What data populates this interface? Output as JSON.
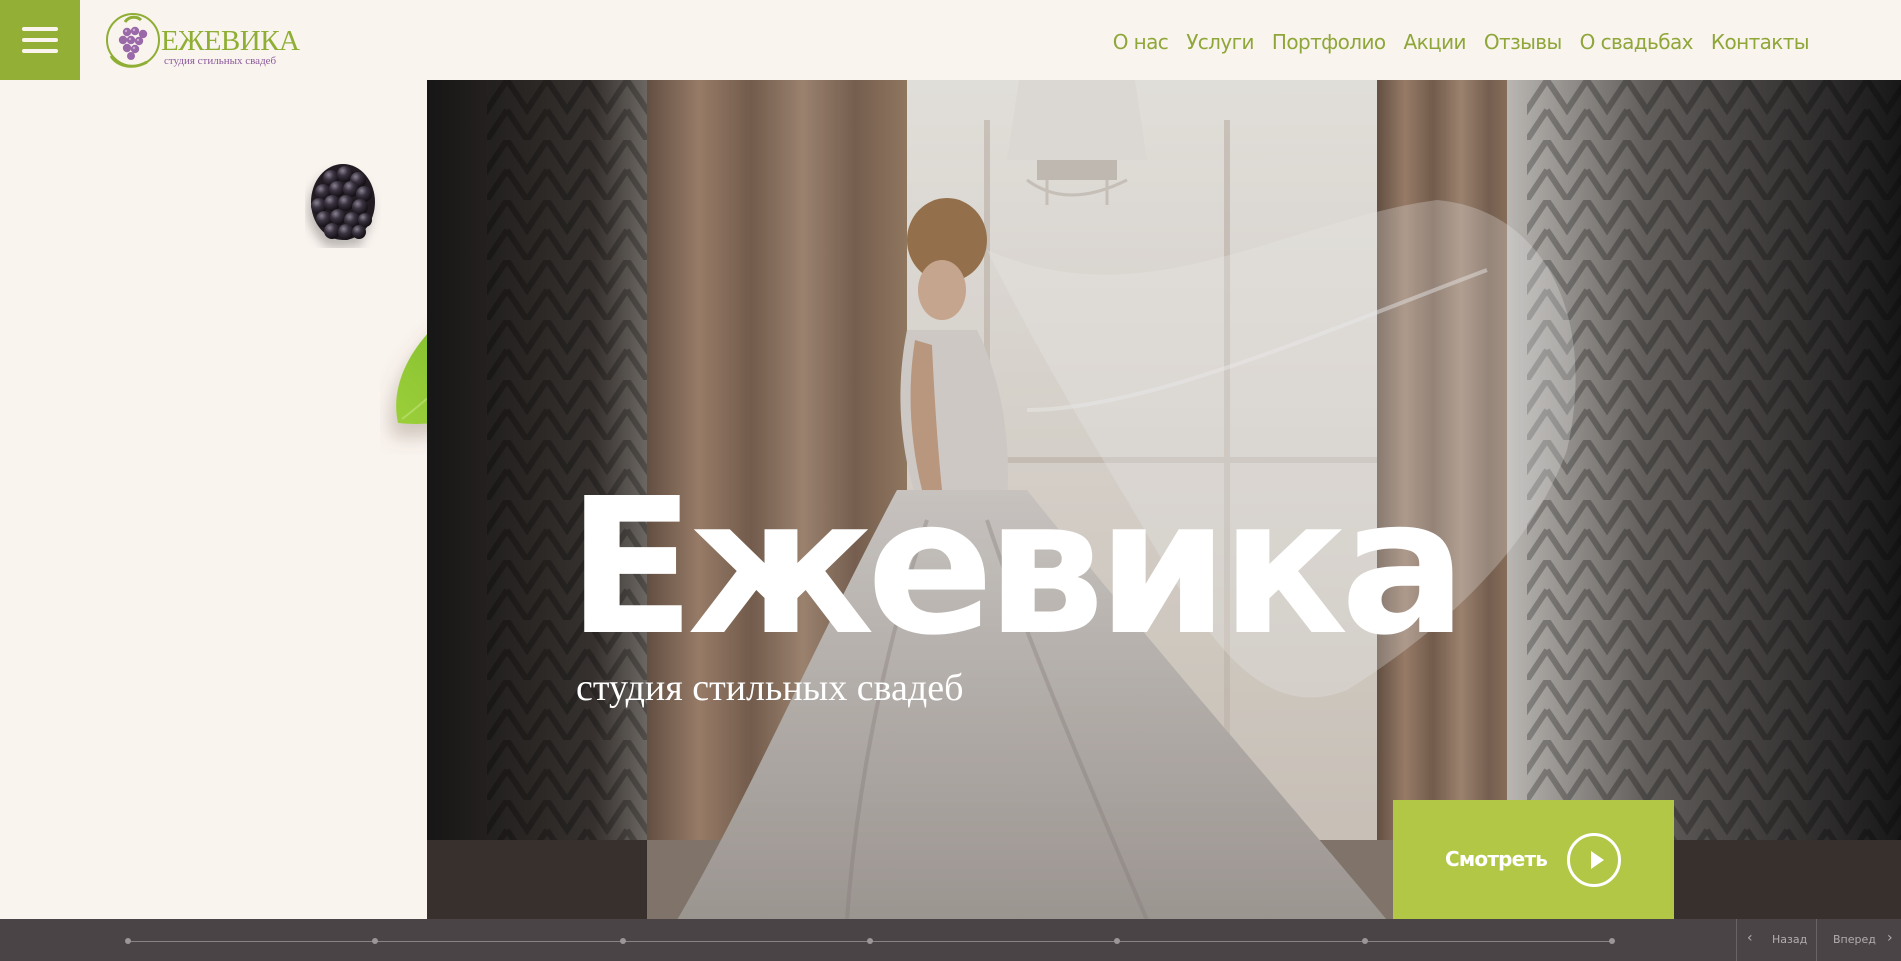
{
  "header": {
    "logo": {
      "name": "ЕЖЕВИКА",
      "tagline": "студия стильных свадеб"
    },
    "nav": [
      {
        "label": "О нас"
      },
      {
        "label": "Услуги"
      },
      {
        "label": "Портфолио"
      },
      {
        "label": "Акции"
      },
      {
        "label": "Отзывы"
      },
      {
        "label": "О свадьбах"
      },
      {
        "label": "Контакты"
      }
    ]
  },
  "hero": {
    "title": "Ежевика",
    "subtitle": "студия стильных свадеб",
    "watch_button": {
      "label": "Смотреть",
      "icon": "play-circle-icon"
    }
  },
  "slider": {
    "slide_count": 7,
    "prev_label": "Назад",
    "next_label": "Вперед"
  },
  "colors": {
    "accent_green": "#93af36",
    "button_green": "#b2c746",
    "nav_text": "#8fa639",
    "page_bg": "#faf4ef",
    "bottom_bar": "#4a4447",
    "logo_purple": "#8a5a9c"
  }
}
